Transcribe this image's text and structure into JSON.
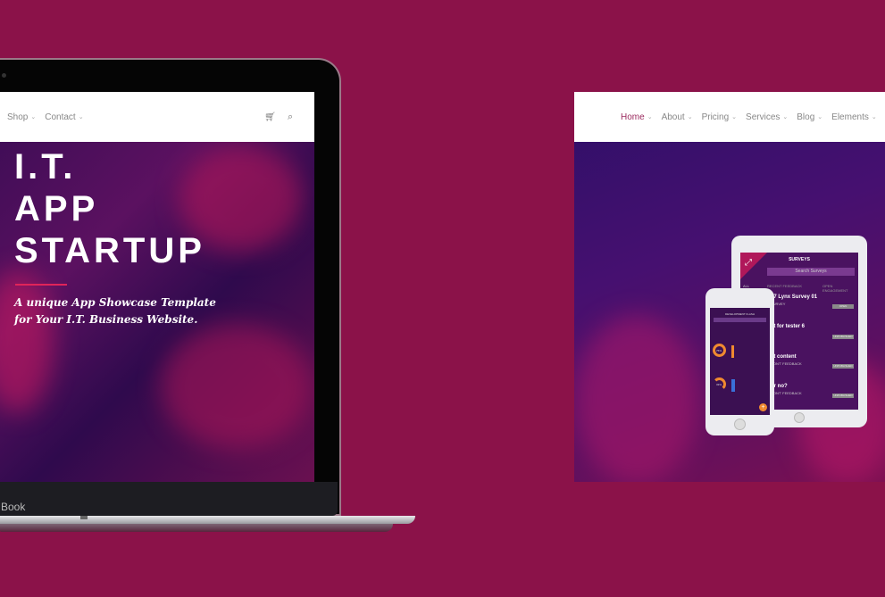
{
  "colors": {
    "background": "#8b1249",
    "accent": "#e0245a"
  },
  "laptop": {
    "brand_fragment": "Book",
    "nav": {
      "items": [
        {
          "label": "Shop"
        },
        {
          "label": "Contact"
        }
      ],
      "icons": [
        "cart-icon",
        "search-icon"
      ]
    },
    "hero": {
      "title_lines": [
        "I.T.",
        "APP",
        "STARTUP"
      ],
      "subtitle_lines": [
        "A unique App Showcase Template",
        "for Your I.T. Business Website."
      ]
    }
  },
  "site": {
    "nav": {
      "items": [
        {
          "label": "Home",
          "active": true
        },
        {
          "label": "About"
        },
        {
          "label": "Pricing"
        },
        {
          "label": "Services"
        },
        {
          "label": "Blog"
        },
        {
          "label": "Elements"
        }
      ]
    },
    "tablet": {
      "title": "SURVEYS",
      "search_placeholder": "Search Surveys",
      "tabs": [
        "ALL",
        "RECENT FEEDBACK",
        "OPEN ENGAGEMENT"
      ],
      "rows": [
        {
          "title": "27 Lynx Survey 01",
          "sub": "SURVEY",
          "button": "OPEN"
        },
        {
          "title": "st for tester 6",
          "sub": "",
          "button": "UNPUBLISHED"
        },
        {
          "title": "st content",
          "sub": "DON'T FEEDBACK",
          "button": "UNPUBLISHED"
        },
        {
          "title": "or no?",
          "sub": "DON'T FEEDBACK",
          "button": "UNPUBLISHED"
        }
      ]
    },
    "phone": {
      "title": "DEVELOPMENT FLASH",
      "values": [
        "75%",
        "33%"
      ]
    }
  }
}
